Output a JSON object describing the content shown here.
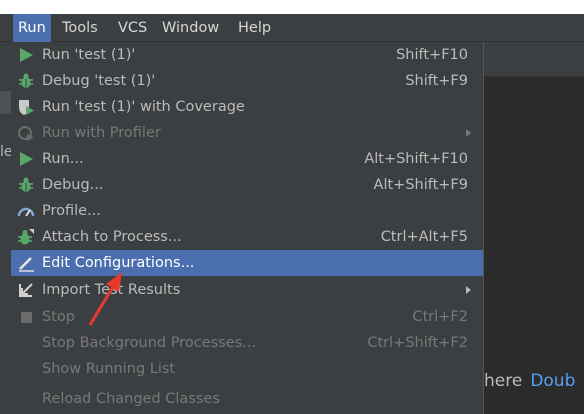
{
  "menubar": {
    "items": [
      {
        "label": "Run"
      },
      {
        "label": "Tools"
      },
      {
        "label": "VCS"
      },
      {
        "label": "Window"
      },
      {
        "label": "Help"
      }
    ]
  },
  "background": {
    "left_fragment": "le",
    "hint_text": "here",
    "hint_link": "Doub"
  },
  "run_menu": {
    "items": [
      {
        "label": "Run 'test (1)'",
        "shortcut": "Shift+F10",
        "icon": "run-triangle-icon"
      },
      {
        "label": "Debug 'test (1)'",
        "shortcut": "Shift+F9",
        "icon": "debug-bug-icon"
      },
      {
        "label": "Run 'test (1)' with Coverage",
        "shortcut": "",
        "icon": "coverage-shield-icon"
      },
      {
        "label": "Run with Profiler",
        "shortcut": "",
        "icon": "profiler-icon",
        "disabled": true,
        "submenu": true
      },
      {
        "label": "Run...",
        "shortcut": "Alt+Shift+F10",
        "icon": "run-triangle-icon"
      },
      {
        "label": "Debug...",
        "shortcut": "Alt+Shift+F9",
        "icon": "debug-bug-icon"
      },
      {
        "label": "Profile...",
        "shortcut": "",
        "icon": "profile-gauge-icon"
      },
      {
        "label": "Attach to Process...",
        "shortcut": "Ctrl+Alt+F5",
        "icon": "attach-bug-icon"
      },
      {
        "label": "Edit Configurations...",
        "shortcut": "",
        "icon": "edit-pencil-icon",
        "selected": true
      },
      {
        "label": "Import Test Results",
        "shortcut": "",
        "icon": "import-arrow-icon",
        "submenu": true
      },
      {
        "label": "Stop",
        "shortcut": "Ctrl+F2",
        "icon": "stop-square-icon",
        "disabled": true
      },
      {
        "label": "Stop Background Processes...",
        "shortcut": "Ctrl+Shift+F2",
        "icon": "",
        "disabled": true
      },
      {
        "label": "Show Running List",
        "shortcut": "",
        "icon": "",
        "disabled": true
      },
      {
        "label": "Reload Changed Classes",
        "shortcut": "",
        "icon": "",
        "disabled": true
      }
    ]
  },
  "colors": {
    "menu_bg": "#3c3f41",
    "selection": "#4b6eaf",
    "text": "#bbbbbb",
    "disabled_text": "#787878",
    "run_green": "#59a869",
    "annotation_red": "#e8392b",
    "link_blue": "#589df6"
  }
}
